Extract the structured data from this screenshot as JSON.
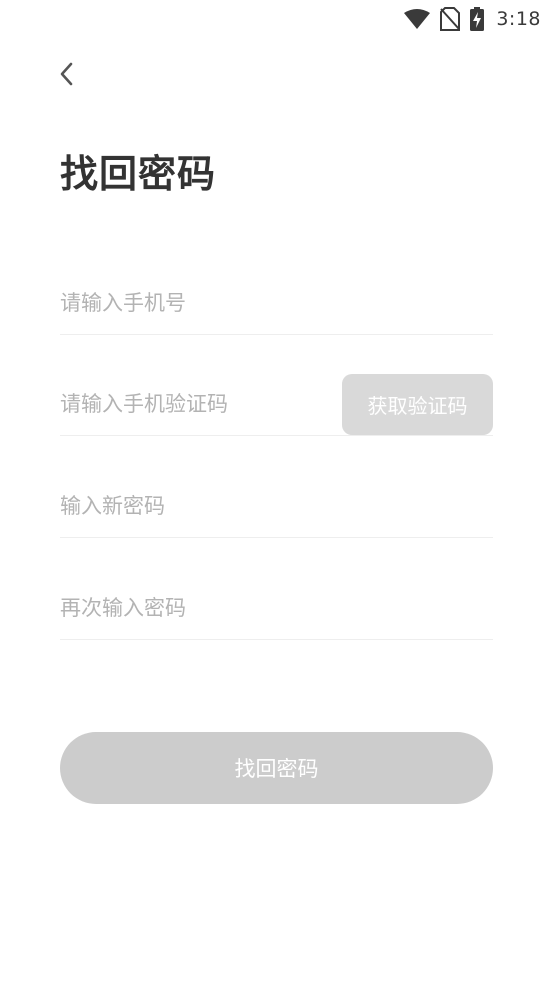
{
  "status_bar": {
    "time": "3:18",
    "icons": [
      "wifi-icon",
      "no-sim-icon",
      "battery-charging-icon"
    ]
  },
  "header": {
    "back_icon": "chevron-left-icon",
    "title": "找回密码"
  },
  "form": {
    "phone_placeholder": "请输入手机号",
    "code_placeholder": "请输入手机验证码",
    "get_code_label": "获取验证码",
    "new_password_placeholder": "输入新密码",
    "confirm_password_placeholder": "再次输入密码"
  },
  "submit": {
    "label": "找回密码"
  },
  "colors": {
    "title": "#333333",
    "placeholder": "#b3b3b3",
    "divider": "#eeeeee",
    "code_button_bg": "#d9d9d9",
    "submit_button_bg": "#cccccc",
    "button_text": "#ffffff"
  }
}
